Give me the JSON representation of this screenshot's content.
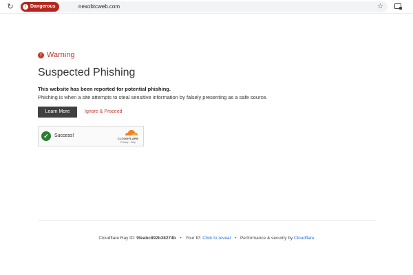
{
  "browser": {
    "reload_icon": "reload-icon",
    "security_chip_label": "Dangerous",
    "security_chip_color": "#b3261e",
    "url": "nexobtcweb.com",
    "bookmark_icon": "star-icon",
    "cast_icon": "cast-icon"
  },
  "warning": {
    "label": "Warning",
    "color": "#c0392b"
  },
  "page_title": "Suspected Phishing",
  "report_text": "This website has been reported for potential phishing.",
  "description": "Phishing is when a site attempts to steal sensitive information by falsely presenting as a safe source.",
  "actions": {
    "learn_more_label": "Learn More",
    "ignore_label": "Ignore & Proceed"
  },
  "turnstile": {
    "status_text": "Success!",
    "status_icon": "check-icon",
    "status_color": "#2e7d32",
    "brand": "CLOUDFLARE",
    "privacy_link": "Privacy",
    "terms_link": "Help"
  },
  "footer": {
    "ray_label": "Cloudflare Ray ID:",
    "ray_id": "9feabc892b38274b",
    "ip_label": "Your IP:",
    "ip_link": "Click to reveal",
    "perf_label": "Performance & security by",
    "perf_link": "Cloudflare",
    "separator": "•",
    "link_color": "#1a6fd8"
  }
}
